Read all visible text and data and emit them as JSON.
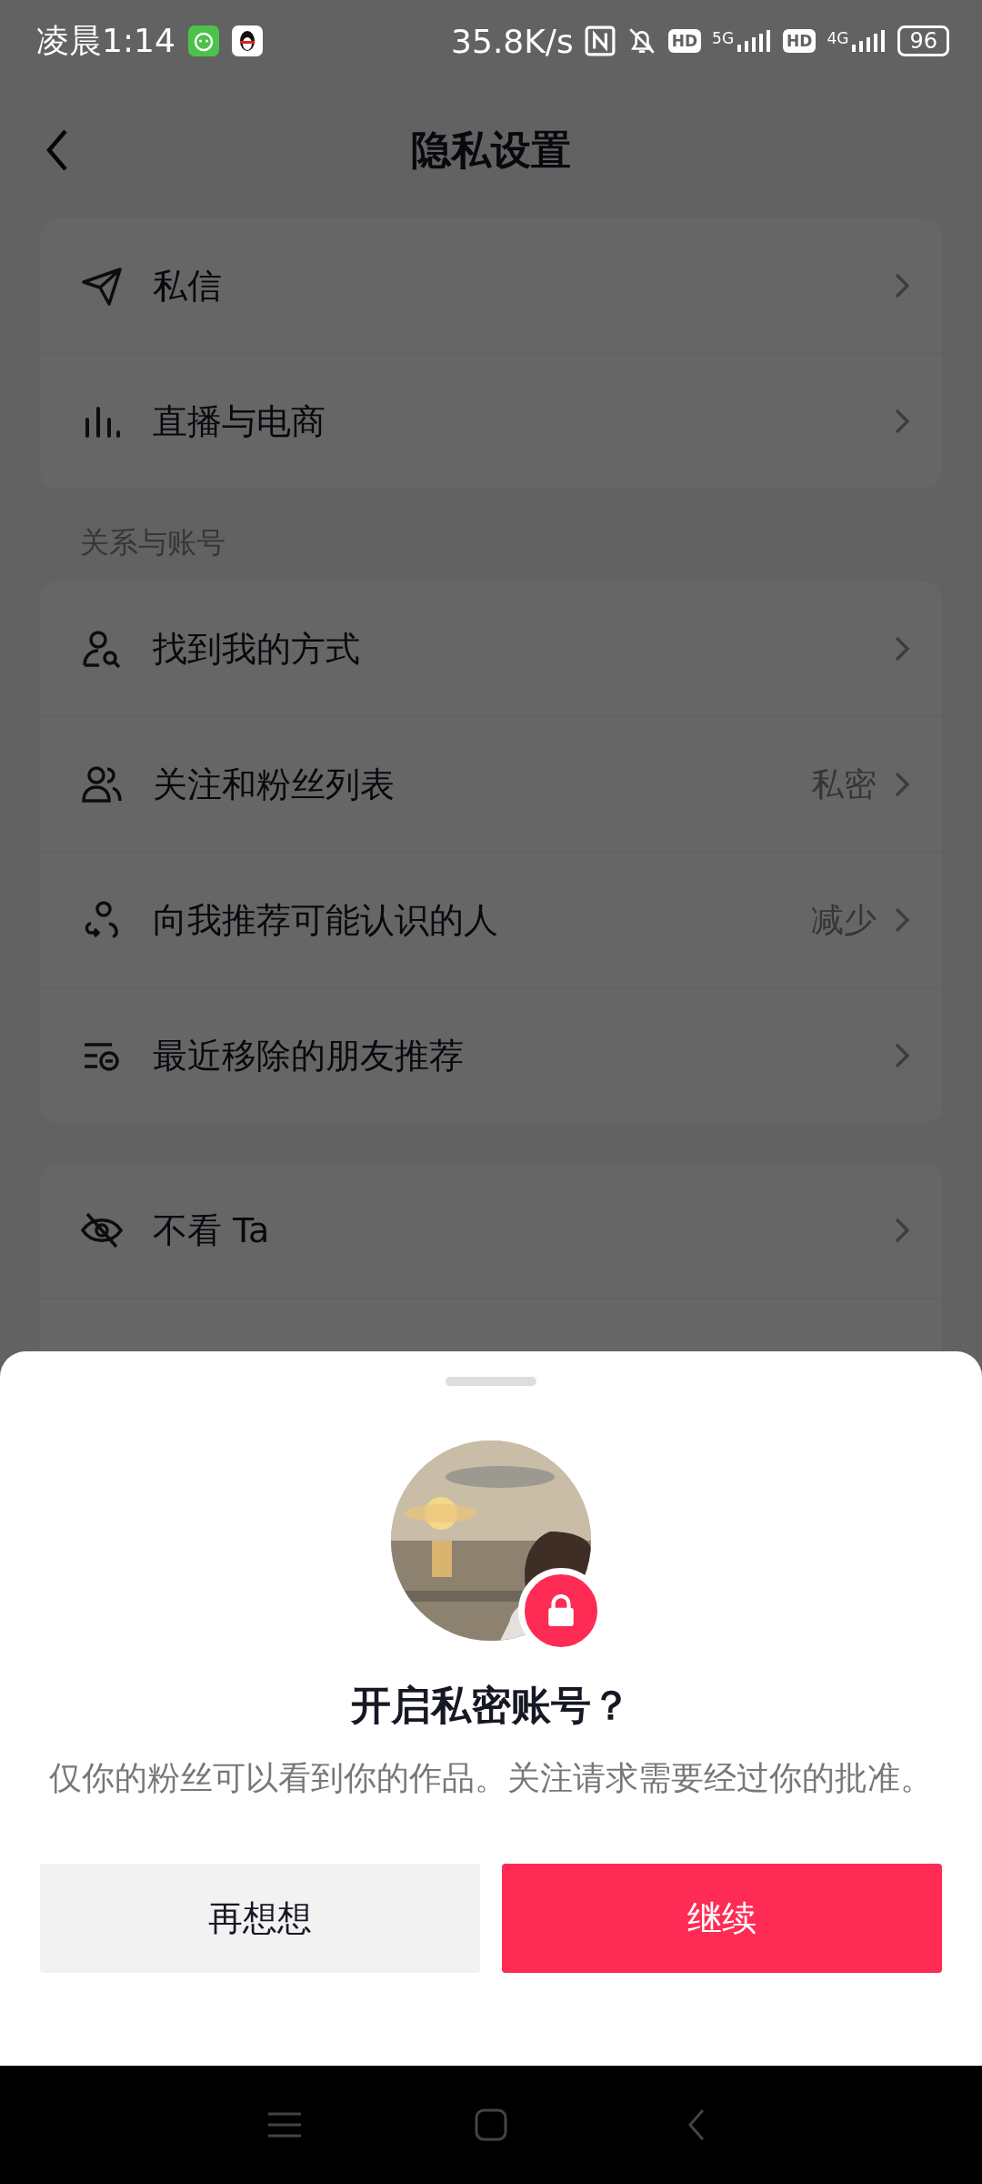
{
  "status_bar": {
    "time": "凌晨1:14",
    "net_speed": "35.8K/s",
    "hd_badges": [
      "HD",
      "HD"
    ],
    "networks": [
      "5G",
      "4G"
    ],
    "battery": "96"
  },
  "header": {
    "title": "隐私设置"
  },
  "sections": [
    {
      "items": [
        {
          "label": "私信"
        },
        {
          "label": "直播与电商"
        }
      ]
    },
    {
      "label": "关系与账号",
      "items": [
        {
          "label": "找到我的方式"
        },
        {
          "label": "关注和粉丝列表",
          "value": "私密"
        },
        {
          "label": "向我推荐可能认识的人",
          "value": "减少"
        },
        {
          "label": "最近移除的朋友推荐"
        }
      ]
    },
    {
      "items": [
        {
          "label": "不看 Ta"
        }
      ]
    }
  ],
  "dialog": {
    "title": "开启私密账号？",
    "description": "仅你的粉丝可以看到你的作品。关注请求需要经过你的批准。",
    "buttons": [
      {
        "label": "再想想",
        "kind": "secondary"
      },
      {
        "label": "继续",
        "kind": "primary"
      }
    ]
  }
}
